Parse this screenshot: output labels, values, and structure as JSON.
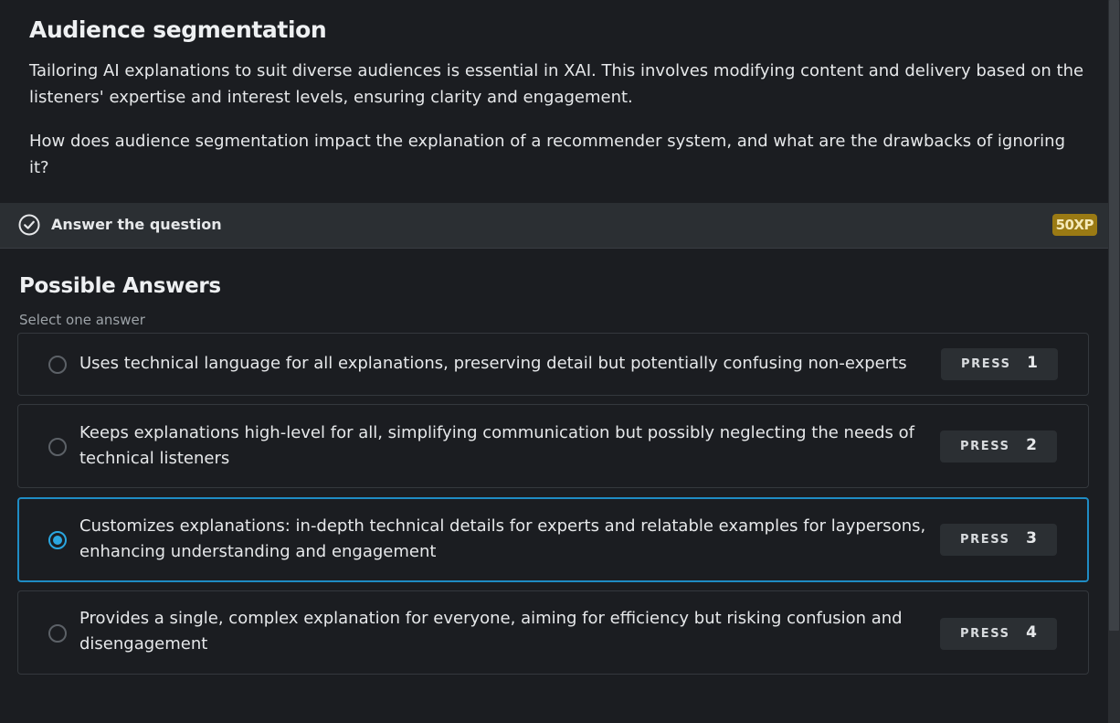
{
  "context": {
    "title": "Audience segmentation",
    "paragraph1": "Tailoring AI explanations to suit diverse audiences is essential in XAI. This involves modifying content and delivery based on the listeners' expertise and interest levels, ensuring clarity and engagement.",
    "paragraph2": "How does audience segmentation impact the explanation of a recommender system, and what are the drawbacks of ignoring it?"
  },
  "task": {
    "label": "Answer the question",
    "xp": "50XP",
    "icon": "check-circle-icon"
  },
  "answers": {
    "title": "Possible Answers",
    "subtitle": "Select one answer",
    "press_word": "PRESS",
    "selected_index": 2,
    "options": [
      {
        "text": "Uses technical language for all explanations, preserving detail but potentially confusing non-experts",
        "key": "1"
      },
      {
        "text": "Keeps explanations high-level for all, simplifying communication but possibly neglecting the needs of technical listeners",
        "key": "2"
      },
      {
        "text": "Customizes explanations: in-depth technical details for experts and relatable examples for laypersons, enhancing understanding and engagement",
        "key": "3"
      },
      {
        "text": "Provides a single, complex explanation for everyone, aiming for efficiency but risking confusion and disengagement",
        "key": "4"
      }
    ]
  },
  "colors": {
    "background": "#1b1d21",
    "selected_accent": "#2aa6e0",
    "xp_badge": "#9a7a14"
  }
}
